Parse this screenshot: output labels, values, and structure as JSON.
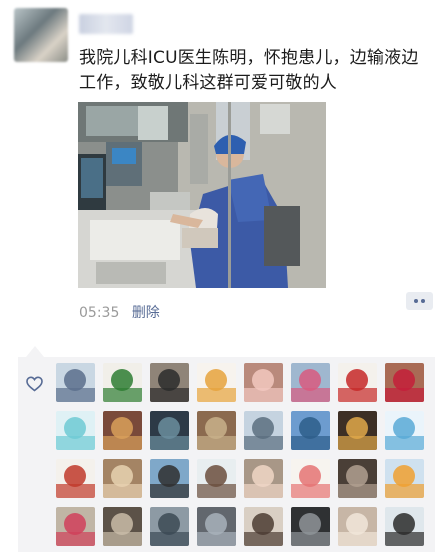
{
  "post": {
    "text": "我院儿科ICU医生陈明，怀抱患儿，边输液边工作，致敬儿科这群可爱可敬的人",
    "time": "05:35",
    "delete_label": "删除"
  },
  "likes": {
    "icon": "heart-outline-icon",
    "avatars": [
      {
        "bg": "#c9d7e3",
        "fg": "#5b6f8c"
      },
      {
        "bg": "#f1efe9",
        "fg": "#2e7d32"
      },
      {
        "bg": "#8f8478",
        "fg": "#2b2b2b"
      },
      {
        "bg": "#f7f3ee",
        "fg": "#e6a23c"
      },
      {
        "bg": "#b98a7c",
        "fg": "#f2c8c0"
      },
      {
        "bg": "#9fb7cf",
        "fg": "#d85a7f"
      },
      {
        "bg": "#f4f1ec",
        "fg": "#c62828"
      },
      {
        "bg": "#a96b55",
        "fg": "#c41e3a"
      },
      {
        "bg": "#dff1f5",
        "fg": "#6ecad4"
      },
      {
        "bg": "#7a4a3a",
        "fg": "#d9a05b"
      },
      {
        "bg": "#2d3a47",
        "fg": "#6b8e9e"
      },
      {
        "bg": "#8b6a4f",
        "fg": "#c8b08a"
      },
      {
        "bg": "#c5d3e0",
        "fg": "#5a6e7f"
      },
      {
        "bg": "#6d9ccf",
        "fg": "#2d5e8a"
      },
      {
        "bg": "#3d2f25",
        "fg": "#e0a84a"
      },
      {
        "bg": "#eaf4fb",
        "fg": "#59a9d6"
      },
      {
        "bg": "#f4f1ec",
        "fg": "#c0392b"
      },
      {
        "bg": "#a48464",
        "fg": "#e8d2b0"
      },
      {
        "bg": "#7fa8c9",
        "fg": "#2f2f2f"
      },
      {
        "bg": "#e8eef0",
        "fg": "#6b4e3d"
      },
      {
        "bg": "#a89787",
        "fg": "#f0d6c6"
      },
      {
        "bg": "#f7f4ef",
        "fg": "#e57373"
      },
      {
        "bg": "#4a3f37",
        "fg": "#b0a090"
      },
      {
        "bg": "#cfe1ef",
        "fg": "#f0a030"
      },
      {
        "bg": "#c0b5a5",
        "fg": "#d0405a"
      },
      {
        "bg": "#5c5248",
        "fg": "#c9bca8"
      },
      {
        "bg": "#8d9aa4",
        "fg": "#3c4a55"
      },
      {
        "bg": "#62676e",
        "fg": "#a8b2bb"
      },
      {
        "bg": "#d9cfc4",
        "fg": "#4b3c33"
      },
      {
        "bg": "#2f3133",
        "fg": "#8f9499"
      },
      {
        "bg": "#c7b6a6",
        "fg": "#f1e6d9"
      },
      {
        "bg": "#dfe7ec",
        "fg": "#2b2b2b"
      }
    ]
  }
}
